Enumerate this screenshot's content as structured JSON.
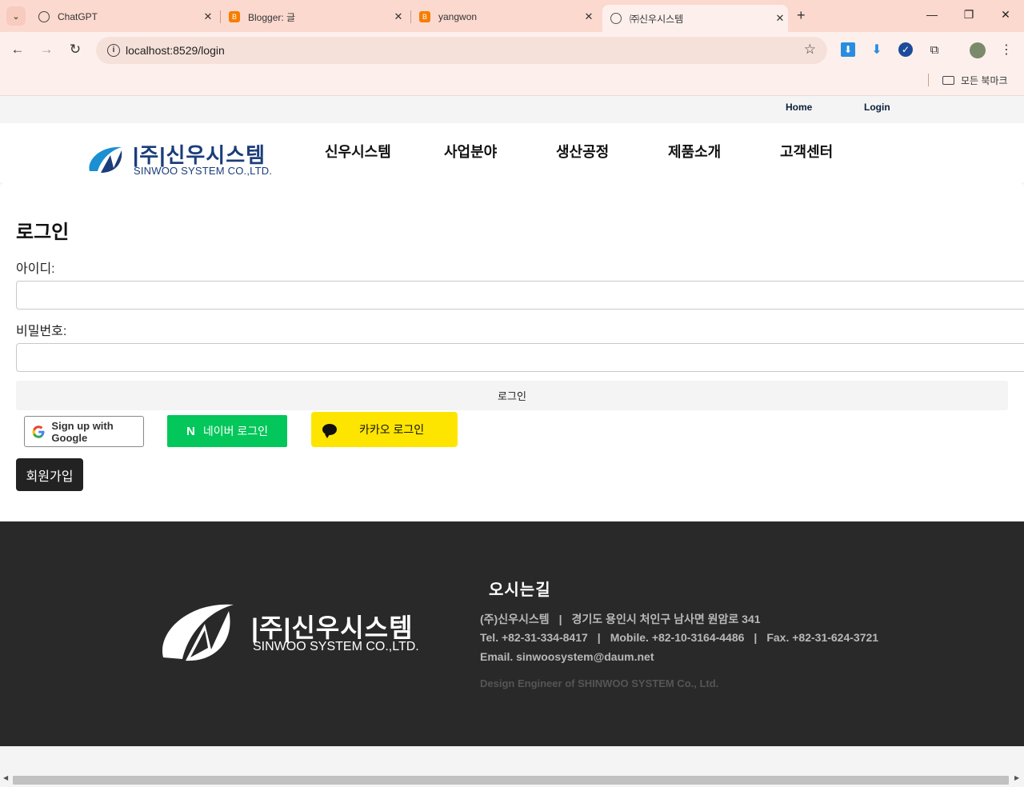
{
  "browser": {
    "tabs": [
      {
        "title": "ChatGPT",
        "icon": "chatgpt-icon"
      },
      {
        "title": "Blogger: 글",
        "icon": "blogger-icon"
      },
      {
        "title": "yangwon",
        "icon": "blogger-icon"
      },
      {
        "title": "㈜신우시스템",
        "icon": "globe-icon"
      }
    ],
    "url": "localhost:8529/login",
    "bookmarks_folder": "모든 북마크"
  },
  "topbar": {
    "home": "Home",
    "login": "Login"
  },
  "header": {
    "logo_kr": "|주|신우시스템",
    "logo_en": "SINWOO SYSTEM CO.,LTD.",
    "nav": [
      "신우시스템",
      "사업분야",
      "생산공정",
      "제품소개",
      "고객센터"
    ]
  },
  "login": {
    "title": "로그인",
    "id_label": "아이디:",
    "pw_label": "비밀번호:",
    "submit": "로그인",
    "google": "Sign up with Google",
    "naver": "네이버 로그인",
    "kakao": "카카오 로그인",
    "join": "회원가입"
  },
  "footer": {
    "logo_kr": "|주|신우시스템",
    "logo_en": "SINWOO SYSTEM CO.,LTD.",
    "title": "오시는길",
    "company": "(주)신우시스템",
    "address": "경기도 용인시 처인구 남사면 원암로 341",
    "tel": "Tel. +82-31-334-8417",
    "mobile": "Mobile. +82-10-3164-4486",
    "fax": "Fax. +82-31-624-3721",
    "email": "Email. sinwoosystem@daum.net",
    "copyright": "Design Engineer of SHINWOO SYSTEM Co., Ltd.",
    "separator": "|"
  },
  "colors": {
    "brand": "#1b3d7a",
    "naver": "#03c75a",
    "kakao": "#fee500",
    "footer_bg": "#292929"
  }
}
